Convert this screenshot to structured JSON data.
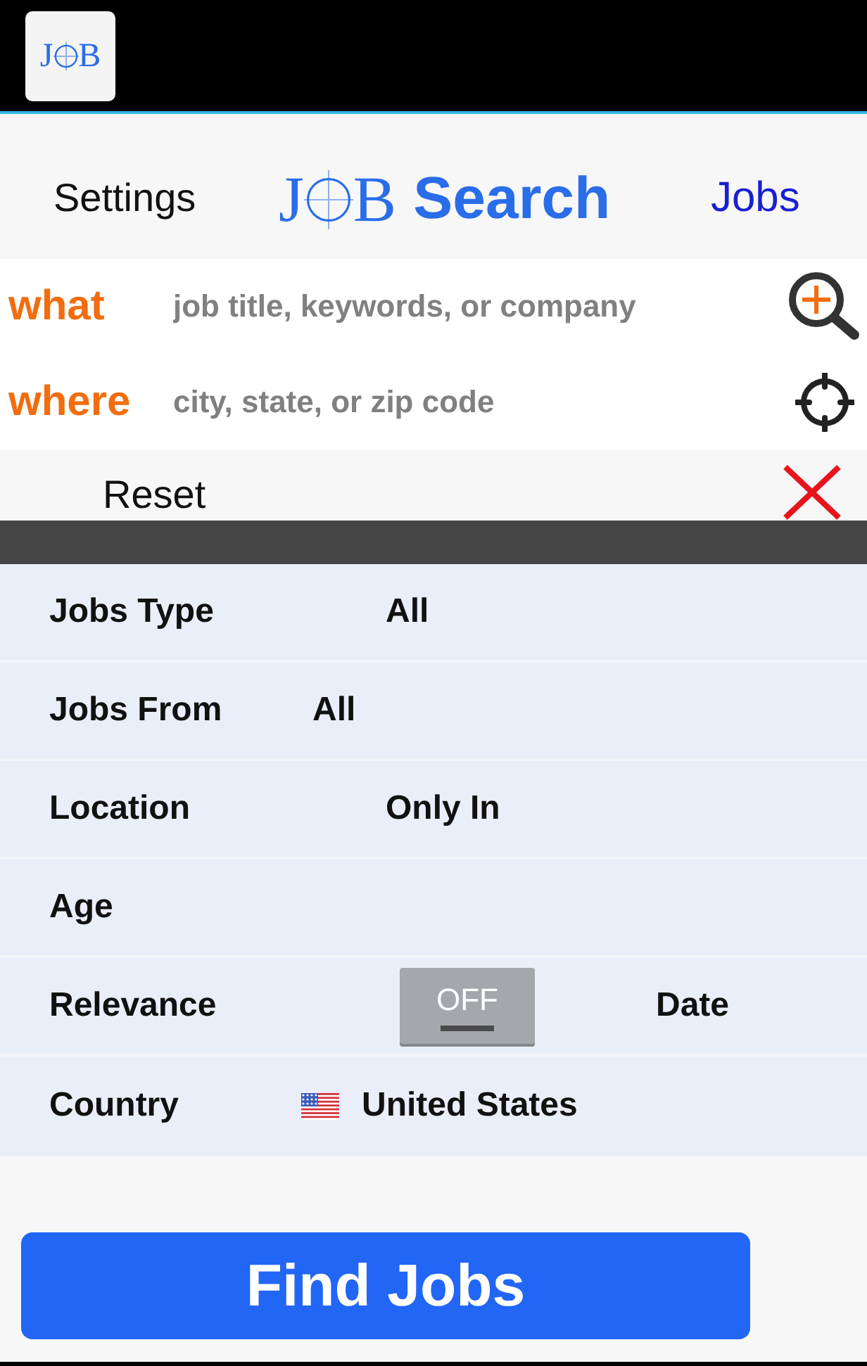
{
  "status_bar": {
    "app_logo": {
      "left": "J",
      "right": "B"
    }
  },
  "header": {
    "settings": "Settings",
    "logo": {
      "left": "J",
      "right": "B"
    },
    "title": "Search",
    "jobs": "Jobs"
  },
  "search_fields": [
    {
      "kind": "keywords",
      "label": "what",
      "placeholder": "job title, keywords, or company"
    },
    {
      "kind": "location",
      "label": "where",
      "placeholder": "city, state, or zip code"
    }
  ],
  "reset": {
    "label": "Reset"
  },
  "options": [
    {
      "kind": "value",
      "label": "Jobs Type",
      "value": "All"
    },
    {
      "kind": "value",
      "label": "Jobs From",
      "value": "All"
    },
    {
      "kind": "value",
      "label": "Location",
      "value": "Only In"
    },
    {
      "kind": "value",
      "label": "Age"
    },
    {
      "kind": "toggle",
      "label": "Relevance",
      "toggle": {
        "label": "OFF",
        "on": false
      },
      "end_label": "Date"
    },
    {
      "kind": "country",
      "label": "Country",
      "value": "United States"
    }
  ],
  "find_button": "Find Jobs"
}
